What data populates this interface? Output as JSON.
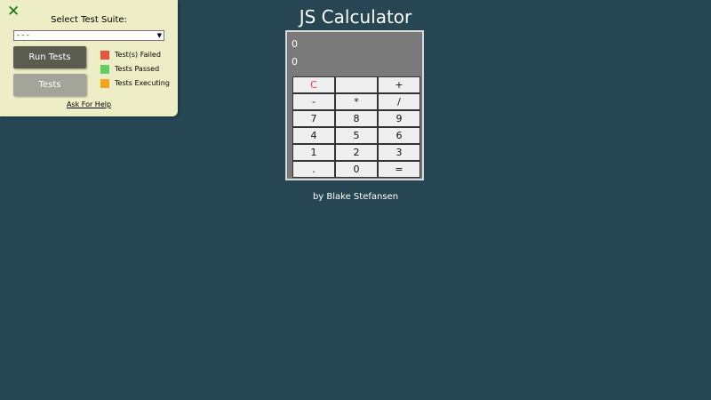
{
  "calculator": {
    "title": "JS Calculator",
    "display": {
      "line1": "0",
      "line2": "0"
    },
    "keys": [
      {
        "label": "C",
        "name": "clear"
      },
      {
        "label": "",
        "name": "blank"
      },
      {
        "label": "+",
        "name": "plus"
      },
      {
        "label": "-",
        "name": "minus"
      },
      {
        "label": "*",
        "name": "multiply"
      },
      {
        "label": "/",
        "name": "divide"
      },
      {
        "label": "7",
        "name": "7"
      },
      {
        "label": "8",
        "name": "8"
      },
      {
        "label": "9",
        "name": "9"
      },
      {
        "label": "4",
        "name": "4"
      },
      {
        "label": "5",
        "name": "5"
      },
      {
        "label": "6",
        "name": "6"
      },
      {
        "label": "1",
        "name": "1"
      },
      {
        "label": "2",
        "name": "2"
      },
      {
        "label": "3",
        "name": "3"
      },
      {
        "label": ".",
        "name": "decimal"
      },
      {
        "label": "0",
        "name": "0"
      },
      {
        "label": "=",
        "name": "equals"
      }
    ],
    "credit": "by Blake Stefansen"
  },
  "test_panel": {
    "close_icon": "close-icon",
    "suite_label": "Select Test Suite:",
    "suite_selected": "- - -",
    "run_button": "Run Tests",
    "tests_button": "Tests",
    "legend": [
      {
        "label": "Test(s) Failed",
        "color": "#e8553e"
      },
      {
        "label": "Tests Passed",
        "color": "#5fcf5f"
      },
      {
        "label": "Tests Executing",
        "color": "#f5a31a"
      }
    ],
    "help_link": "Ask For Help"
  },
  "colors": {
    "background": "#264653",
    "panel": "#eeeec6",
    "calc_body": "#7a7a7a",
    "clear_key": "#e63946"
  }
}
